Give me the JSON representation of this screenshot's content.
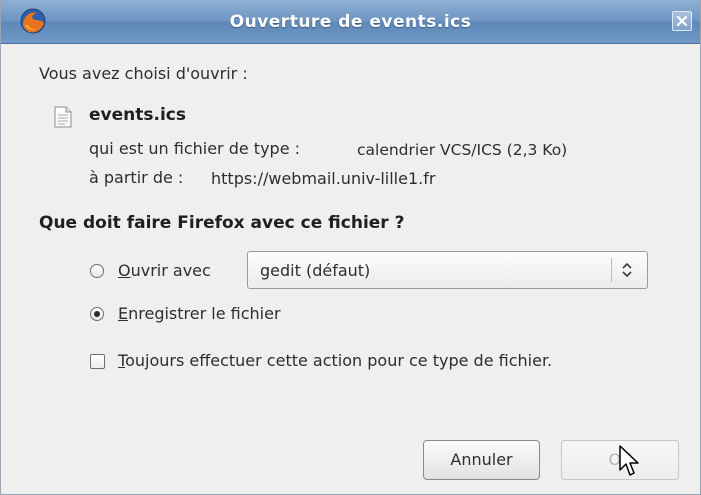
{
  "window": {
    "title": "Ouverture de events.ics",
    "app_icon": "firefox-icon",
    "close_icon": "close-icon"
  },
  "intro": "Vous avez choisi d'ouvrir :",
  "file": {
    "icon": "document-icon",
    "name": "events.ics",
    "type_label": "qui est un fichier de type :",
    "type_value": "calendrier VCS/ICS (2,3 Ko)",
    "from_label": "à partir de :",
    "from_value": "https://webmail.univ-lille1.fr"
  },
  "question": "Que doit faire Firefox avec ce fichier ?",
  "options": {
    "open_with": {
      "accesskey": "O",
      "label_rest": "uvrir avec",
      "checked": false
    },
    "open_with_select": {
      "value": "gedit (défaut)",
      "icon": "up-down-arrows-icon"
    },
    "save": {
      "accesskey": "E",
      "label_rest": "nregistrer le fichier",
      "checked": true
    },
    "always": {
      "accesskey": "T",
      "label_rest": "oujours effectuer cette action pour ce type de fichier.",
      "checked": false
    }
  },
  "buttons": {
    "cancel": "Annuler",
    "ok": "OK",
    "ok_enabled": false
  },
  "colors": {
    "titlebar": "#6e96c2",
    "dialog_bg": "#efefef"
  }
}
